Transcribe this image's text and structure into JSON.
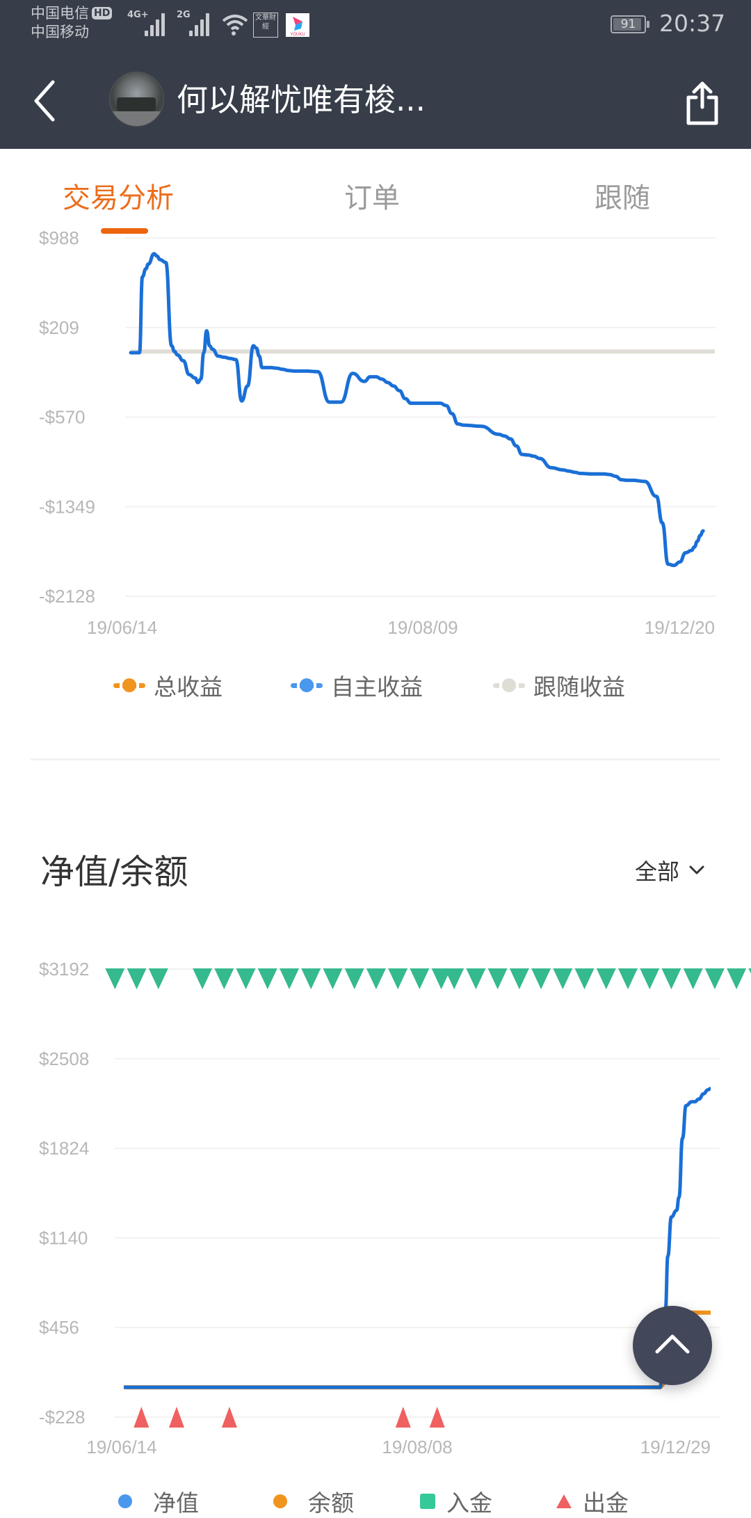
{
  "status_bar": {
    "carrier1": "中国电信",
    "carrier1_badge": "HD",
    "carrier2": "中国移动",
    "network1": "4G+",
    "network2": "2G",
    "app_icons": [
      "wenhua-caijing-icon",
      "youku-icon"
    ],
    "app_icon1_text": "文華財經",
    "app_icon2_text": "YOUKU",
    "battery_level": "91",
    "battery_percent": 91,
    "time": "20:37"
  },
  "nav": {
    "title": "何以解忧唯有梭...",
    "back_icon": "chevron-left-icon",
    "share_icon": "share-icon"
  },
  "tabs": [
    {
      "label": "交易分析",
      "active": true
    },
    {
      "label": "订单",
      "active": false
    },
    {
      "label": "跟随",
      "active": false
    }
  ],
  "colors": {
    "accent": "#ec6d1c",
    "header_bg": "#373e49",
    "self_profit": "#1a6fd6",
    "total_profit": "#f0941e",
    "follow_profit": "#e0ddd6",
    "deposit": "#35b98e",
    "withdraw": "#f06060"
  },
  "section2": {
    "title": "净值/余额",
    "filter_label": "全部"
  },
  "chart_data": [
    {
      "type": "line",
      "title": "",
      "xlabel": "",
      "ylabel": "",
      "ylim": [
        -2128,
        988
      ],
      "y_ticks": [
        "$988",
        "$209",
        "-$570",
        "-$1349",
        "-$2128"
      ],
      "y_tick_values": [
        988,
        209,
        -570,
        -1349,
        -2128
      ],
      "x_ticks": [
        "19/06/14",
        "19/08/09",
        "19/12/20"
      ],
      "x_range": [
        0,
        100
      ],
      "x_tick_positions": [
        0,
        50,
        100
      ],
      "grid": true,
      "legend": [
        "总收益",
        "自主收益",
        "跟随收益"
      ],
      "legend_position": "bottom",
      "series": [
        {
          "name": "自主收益",
          "color": "#1a6fd6",
          "x": [
            0,
            1.5,
            2,
            2.6,
            3,
            4,
            4.5,
            5,
            6,
            7,
            7.5,
            8,
            9,
            10,
            11,
            11.5,
            12,
            12.5,
            13,
            13.5,
            14,
            15,
            16,
            17,
            18,
            19,
            20,
            21,
            21.5,
            22,
            22.5,
            23,
            24,
            25,
            26,
            27,
            28,
            30,
            32,
            34,
            36,
            38,
            40,
            41,
            42,
            43,
            44,
            45,
            46,
            47,
            48,
            50,
            52,
            53,
            54,
            55,
            56,
            57,
            60,
            63,
            64,
            65,
            66,
            67,
            68,
            69,
            70,
            72,
            74,
            75,
            76,
            77,
            79,
            81,
            82,
            83,
            84,
            85,
            86,
            88,
            90,
            91,
            92,
            93,
            94,
            95,
            96,
            96.5,
            97,
            97.5,
            98,
            98.5,
            99,
            99.5,
            100
          ],
          "y": [
            -10,
            -10,
            650,
            720,
            760,
            850,
            830,
            800,
            775,
            50,
            0,
            -30,
            -80,
            -200,
            -230,
            -270,
            -240,
            -10,
            180,
            50,
            20,
            -40,
            -50,
            -60,
            -70,
            -430,
            -300,
            50,
            30,
            -40,
            -140,
            -140,
            -140,
            -145,
            -155,
            -165,
            -170,
            -170,
            -175,
            -440,
            -440,
            -190,
            -260,
            -220,
            -220,
            -240,
            -270,
            -300,
            -340,
            -410,
            -450,
            -450,
            -450,
            -450,
            -470,
            -540,
            -630,
            -640,
            -650,
            -720,
            -735,
            -760,
            -820,
            -895,
            -900,
            -910,
            -930,
            -1010,
            -1030,
            -1040,
            -1050,
            -1060,
            -1065,
            -1065,
            -1070,
            -1085,
            -1115,
            -1120,
            -1120,
            -1130,
            -1260,
            -1490,
            -1850,
            -1860,
            -1830,
            -1750,
            -1730,
            -1700,
            -1650,
            -1600,
            -1560
          ]
        },
        {
          "name": "跟随收益",
          "color": "#e0ddd6",
          "x": [
            0,
            100
          ],
          "y": [
            0,
            0
          ]
        },
        {
          "name": "总收益",
          "color": "#f0941e",
          "x": [],
          "y": []
        }
      ]
    },
    {
      "type": "line",
      "title": "净值/余额",
      "xlabel": "",
      "ylabel": "",
      "ylim": [
        -228,
        3192
      ],
      "y_ticks": [
        "$3192",
        "$2508",
        "$1824",
        "$1140",
        "$456",
        "-$228"
      ],
      "y_tick_values": [
        3192,
        2508,
        1824,
        1140,
        456,
        -228
      ],
      "x_ticks": [
        "19/06/14",
        "19/08/08",
        "19/12/29"
      ],
      "x_range": [
        0,
        100
      ],
      "x_tick_positions": [
        0,
        50,
        100
      ],
      "grid": true,
      "legend": [
        "净值",
        "余额",
        "入金",
        "出金"
      ],
      "legend_position": "bottom",
      "series": [
        {
          "name": "余额",
          "color": "#f0941e",
          "x": [
            0,
            91.4,
            92.2,
            94.2,
            100
          ],
          "y": [
            0,
            0,
            40,
            570,
            570
          ]
        },
        {
          "name": "净值",
          "color": "#1a6fd6",
          "x": [
            0,
            91.4,
            91.8,
            92.3,
            92.7,
            93.3,
            94.2,
            94.6,
            95.2,
            95.8,
            96.8,
            97.3,
            98,
            98.8,
            99.5,
            100
          ],
          "y": [
            0,
            0,
            200,
            600,
            1000,
            1300,
            1350,
            1450,
            1900,
            2150,
            2180,
            2180,
            2200,
            2240,
            2270,
            2280
          ]
        },
        {
          "name": "入金",
          "color": "#35b98e",
          "marker": "down-triangle",
          "at_value": 3192,
          "x": [
            -1.5,
            2.2,
            5.9,
            13.4,
            17.1,
            20.8,
            24.5,
            28.2,
            31.9,
            35.6,
            39.3,
            43,
            46.7,
            50.4,
            54.1,
            56.3,
            60,
            63.7,
            67.4,
            71.1,
            74.8,
            78.5,
            82.2,
            85.9,
            89.6,
            93.3,
            97,
            100.7,
            104.4,
            108.1
          ]
        },
        {
          "name": "出金",
          "color": "#f06060",
          "marker": "up-triangle",
          "at_value": -228,
          "x": [
            3,
            9,
            18,
            47.6,
            53.4
          ]
        }
      ]
    }
  ]
}
